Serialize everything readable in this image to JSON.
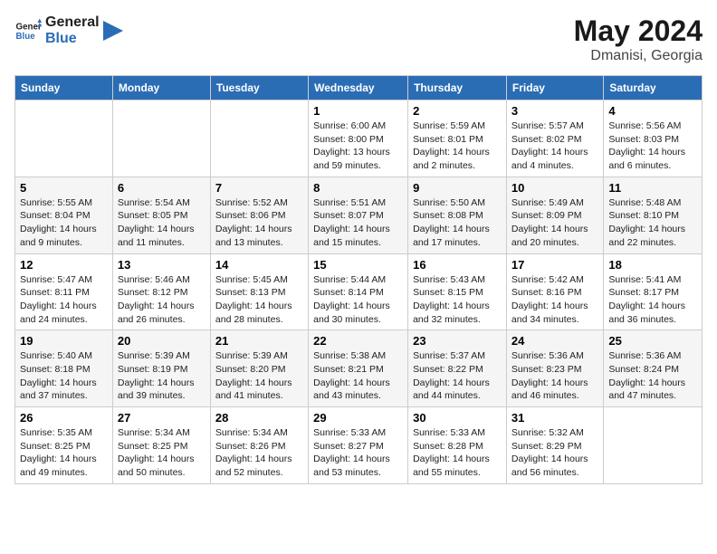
{
  "logo": {
    "line1": "General",
    "line2": "Blue"
  },
  "title": "May 2024",
  "location": "Dmanisi, Georgia",
  "weekdays": [
    "Sunday",
    "Monday",
    "Tuesday",
    "Wednesday",
    "Thursday",
    "Friday",
    "Saturday"
  ],
  "weeks": [
    [
      {
        "day": "",
        "info": ""
      },
      {
        "day": "",
        "info": ""
      },
      {
        "day": "",
        "info": ""
      },
      {
        "day": "1",
        "info": "Sunrise: 6:00 AM\nSunset: 8:00 PM\nDaylight: 13 hours\nand 59 minutes."
      },
      {
        "day": "2",
        "info": "Sunrise: 5:59 AM\nSunset: 8:01 PM\nDaylight: 14 hours\nand 2 minutes."
      },
      {
        "day": "3",
        "info": "Sunrise: 5:57 AM\nSunset: 8:02 PM\nDaylight: 14 hours\nand 4 minutes."
      },
      {
        "day": "4",
        "info": "Sunrise: 5:56 AM\nSunset: 8:03 PM\nDaylight: 14 hours\nand 6 minutes."
      }
    ],
    [
      {
        "day": "5",
        "info": "Sunrise: 5:55 AM\nSunset: 8:04 PM\nDaylight: 14 hours\nand 9 minutes."
      },
      {
        "day": "6",
        "info": "Sunrise: 5:54 AM\nSunset: 8:05 PM\nDaylight: 14 hours\nand 11 minutes."
      },
      {
        "day": "7",
        "info": "Sunrise: 5:52 AM\nSunset: 8:06 PM\nDaylight: 14 hours\nand 13 minutes."
      },
      {
        "day": "8",
        "info": "Sunrise: 5:51 AM\nSunset: 8:07 PM\nDaylight: 14 hours\nand 15 minutes."
      },
      {
        "day": "9",
        "info": "Sunrise: 5:50 AM\nSunset: 8:08 PM\nDaylight: 14 hours\nand 17 minutes."
      },
      {
        "day": "10",
        "info": "Sunrise: 5:49 AM\nSunset: 8:09 PM\nDaylight: 14 hours\nand 20 minutes."
      },
      {
        "day": "11",
        "info": "Sunrise: 5:48 AM\nSunset: 8:10 PM\nDaylight: 14 hours\nand 22 minutes."
      }
    ],
    [
      {
        "day": "12",
        "info": "Sunrise: 5:47 AM\nSunset: 8:11 PM\nDaylight: 14 hours\nand 24 minutes."
      },
      {
        "day": "13",
        "info": "Sunrise: 5:46 AM\nSunset: 8:12 PM\nDaylight: 14 hours\nand 26 minutes."
      },
      {
        "day": "14",
        "info": "Sunrise: 5:45 AM\nSunset: 8:13 PM\nDaylight: 14 hours\nand 28 minutes."
      },
      {
        "day": "15",
        "info": "Sunrise: 5:44 AM\nSunset: 8:14 PM\nDaylight: 14 hours\nand 30 minutes."
      },
      {
        "day": "16",
        "info": "Sunrise: 5:43 AM\nSunset: 8:15 PM\nDaylight: 14 hours\nand 32 minutes."
      },
      {
        "day": "17",
        "info": "Sunrise: 5:42 AM\nSunset: 8:16 PM\nDaylight: 14 hours\nand 34 minutes."
      },
      {
        "day": "18",
        "info": "Sunrise: 5:41 AM\nSunset: 8:17 PM\nDaylight: 14 hours\nand 36 minutes."
      }
    ],
    [
      {
        "day": "19",
        "info": "Sunrise: 5:40 AM\nSunset: 8:18 PM\nDaylight: 14 hours\nand 37 minutes."
      },
      {
        "day": "20",
        "info": "Sunrise: 5:39 AM\nSunset: 8:19 PM\nDaylight: 14 hours\nand 39 minutes."
      },
      {
        "day": "21",
        "info": "Sunrise: 5:39 AM\nSunset: 8:20 PM\nDaylight: 14 hours\nand 41 minutes."
      },
      {
        "day": "22",
        "info": "Sunrise: 5:38 AM\nSunset: 8:21 PM\nDaylight: 14 hours\nand 43 minutes."
      },
      {
        "day": "23",
        "info": "Sunrise: 5:37 AM\nSunset: 8:22 PM\nDaylight: 14 hours\nand 44 minutes."
      },
      {
        "day": "24",
        "info": "Sunrise: 5:36 AM\nSunset: 8:23 PM\nDaylight: 14 hours\nand 46 minutes."
      },
      {
        "day": "25",
        "info": "Sunrise: 5:36 AM\nSunset: 8:24 PM\nDaylight: 14 hours\nand 47 minutes."
      }
    ],
    [
      {
        "day": "26",
        "info": "Sunrise: 5:35 AM\nSunset: 8:25 PM\nDaylight: 14 hours\nand 49 minutes."
      },
      {
        "day": "27",
        "info": "Sunrise: 5:34 AM\nSunset: 8:25 PM\nDaylight: 14 hours\nand 50 minutes."
      },
      {
        "day": "28",
        "info": "Sunrise: 5:34 AM\nSunset: 8:26 PM\nDaylight: 14 hours\nand 52 minutes."
      },
      {
        "day": "29",
        "info": "Sunrise: 5:33 AM\nSunset: 8:27 PM\nDaylight: 14 hours\nand 53 minutes."
      },
      {
        "day": "30",
        "info": "Sunrise: 5:33 AM\nSunset: 8:28 PM\nDaylight: 14 hours\nand 55 minutes."
      },
      {
        "day": "31",
        "info": "Sunrise: 5:32 AM\nSunset: 8:29 PM\nDaylight: 14 hours\nand 56 minutes."
      },
      {
        "day": "",
        "info": ""
      }
    ]
  ]
}
